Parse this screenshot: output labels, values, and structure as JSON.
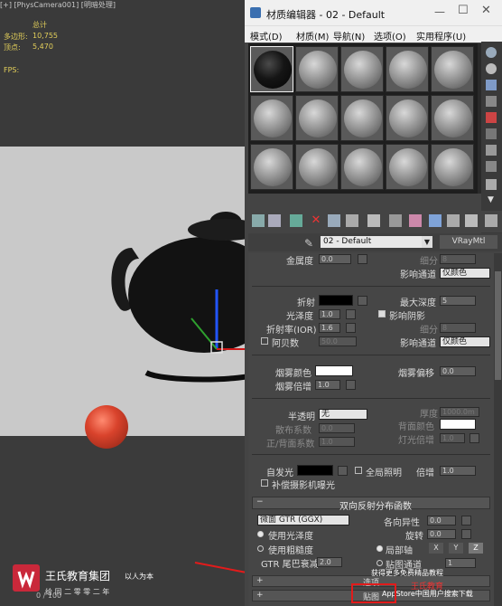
{
  "viewport": {
    "header": "[+] [PhysCamera001] [明暗处理]",
    "stats": {
      "total_label": "总计",
      "poly_label": "多边形:",
      "poly_value": "10,755",
      "vert_label": "顶点:",
      "vert_value": "5,470",
      "fps_label": "FPS:"
    },
    "timeline": "0 / 100",
    "watermark_brand": "王氏教育集团",
    "watermark_sub": "以人为本",
    "watermark_line2": "给  同  二  零  零  二  年",
    "watermark_right": "获得更多免费精品教程",
    "watermark_appstore": "AppStore中国用户搜索下载",
    "watermark_app": "王氏教育"
  },
  "material_editor": {
    "title": "材质编辑器 - 02 - Default",
    "menu": [
      "模式(D)",
      "材质(M)",
      "导航(N)",
      "选项(O)",
      "实用程序(U)"
    ],
    "material_name": "02 - Default",
    "material_type": "VRayMtl",
    "params": {
      "metalness_label": "金属度",
      "metalness_value": "0.0",
      "subdiv_label": "细分",
      "subdiv_value": "8",
      "affect_channels_label": "影响通道",
      "affect_channels_value": "仅颜色",
      "refraction_label": "折射",
      "max_depth_label": "最大深度",
      "max_depth_value": "5",
      "glossiness_label": "光泽度",
      "glossiness_value": "1.0",
      "affect_shadows_label": "影响阴影",
      "ior_label": "折射率(IOR)",
      "ior_value": "1.6",
      "subdiv2_label": "细分",
      "subdiv2_value": "8",
      "abbe_label": "阿贝数",
      "abbe_value": "50.0",
      "affect_channels2_label": "影响通道",
      "affect_channels2_value": "仅颜色",
      "fog_color_label": "烟雾颜色",
      "fog_bias_label": "烟雾偏移",
      "fog_bias_value": "0.0",
      "fog_mult_label": "烟雾倍增",
      "fog_mult_value": "1.0",
      "translucency_label": "半透明",
      "translucency_value": "无",
      "thickness_label": "厚度",
      "thickness_value": "1000.0m",
      "scatter_label": "散布系数",
      "scatter_value": "0.0",
      "back_color_label": "背面颜色",
      "fb_label": "正/背面系数",
      "fb_value": "1.0",
      "light_mult_label": "灯光倍增",
      "light_mult_value": "1.0",
      "self_illum_label": "自发光",
      "gi_label": "全局照明",
      "mult_label": "倍增",
      "mult_value": "1.0",
      "comp_exposure_label": "补偿摄影机曝光",
      "brdf_title": "双向反射分布函数",
      "brdf_type": "微面 GTR (GGX)",
      "anisotropy_label": "各向异性",
      "anisotropy_value": "0.0",
      "use_gloss_label": "使用光泽度",
      "rotation_label": "旋转",
      "rotation_value": "0.0",
      "use_rough_label": "使用粗糙度",
      "local_axis_label": "局部轴",
      "axis_x": "X",
      "axis_y": "Y",
      "axis_z": "Z",
      "gtr_label": "GTR 尾巴衰减",
      "gtr_value": "2.0",
      "map_channel_label": "贴图通道",
      "map_channel_value": "1",
      "options_label": "选项",
      "maps_label": "贴图"
    }
  },
  "colors": {
    "refraction_swatch": "#000000",
    "fog_swatch": "#ffffff",
    "back_swatch": "#ffffff",
    "selfillum_swatch": "#000000",
    "accent": "#c9283a"
  }
}
